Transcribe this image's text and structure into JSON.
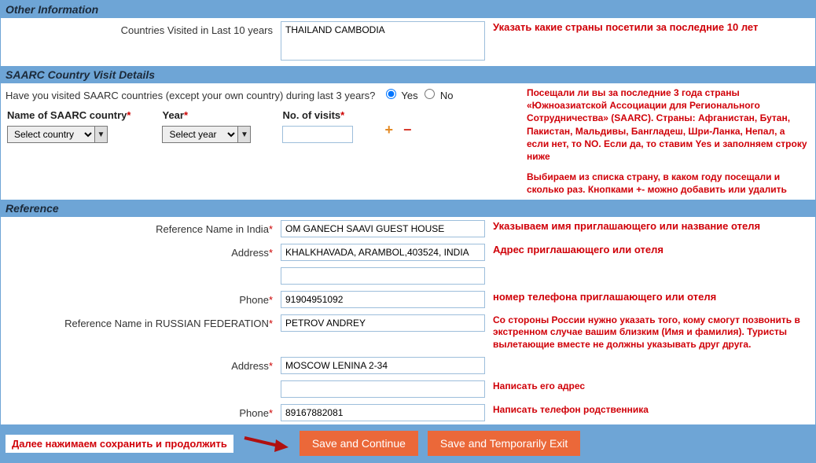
{
  "sections": {
    "other": "Other Information",
    "saarc": "SAARC Country Visit Details",
    "reference": "Reference"
  },
  "other": {
    "countries_label": "Countries Visited in Last 10 years",
    "countries_value": "THAILAND CAMBODIA",
    "countries_note": "Указать какие страны посетили за последние 10 лет"
  },
  "saarc": {
    "question": "Have you visited SAARC countries (except your own country) during last 3 years?",
    "yes": "Yes",
    "no": "No",
    "col_country": "Name of SAARC country",
    "col_year": "Year",
    "col_visits": "No. of visits",
    "sel_country": "Select country",
    "sel_year": "Select year",
    "visits_value": "",
    "note1": "Посещали ли вы за последние 3 года страны «Южноазиатской Ассоциации для Регионального Сотрудничества» (SAARC). Страны: Афганистан, Бутан, Пакистан, Мальдивы, Бангладеш, Шри-Ланка, Непал, а если нет, то NO. Если да, то ставим Yes и заполняем строку ниже",
    "note2": "Выбираем из списка страну, в каком году посещали и сколько раз. Кнопками +- можно добавить или удалить"
  },
  "reference": {
    "name_india_lbl": "Reference Name in India",
    "name_india_val": "OM GANECH SAAVI GUEST HOUSE",
    "name_india_note": "Указываем имя приглашающего или название отеля",
    "addr_india_lbl": "Address",
    "addr_india_val": "KHALKHAVADA, ARAMBOL,403524, INDIA",
    "addr_india_note": "Адрес приглашающего или  отеля",
    "addr_india_val2": "",
    "phone_india_lbl": "Phone",
    "phone_india_val": "91904951092",
    "phone_india_note": "номер телефона приглашающего или отеля",
    "name_ru_lbl": "Reference Name in RUSSIAN FEDERATION",
    "name_ru_val": "PETROV ANDREY",
    "name_ru_note": "Со стороны России нужно указать того, кому смогут позвонить в экстренном случае вашим близким (Имя и фамилия). Туристы вылетающие вместе не должны указывать друг друга.",
    "addr_ru_lbl": "Address",
    "addr_ru_val": "MOSCOW LENINA 2-34",
    "addr_ru_val2": "",
    "addr_ru_note": "Написать его адрес",
    "phone_ru_lbl": "Phone",
    "phone_ru_val": "89167882081",
    "phone_ru_note": "Написать телефон родственника"
  },
  "footer": {
    "instr": "Далее нажимаем сохранить и продолжить",
    "save_continue": "Save and Continue",
    "save_exit": "Save and Temporarily Exit"
  }
}
